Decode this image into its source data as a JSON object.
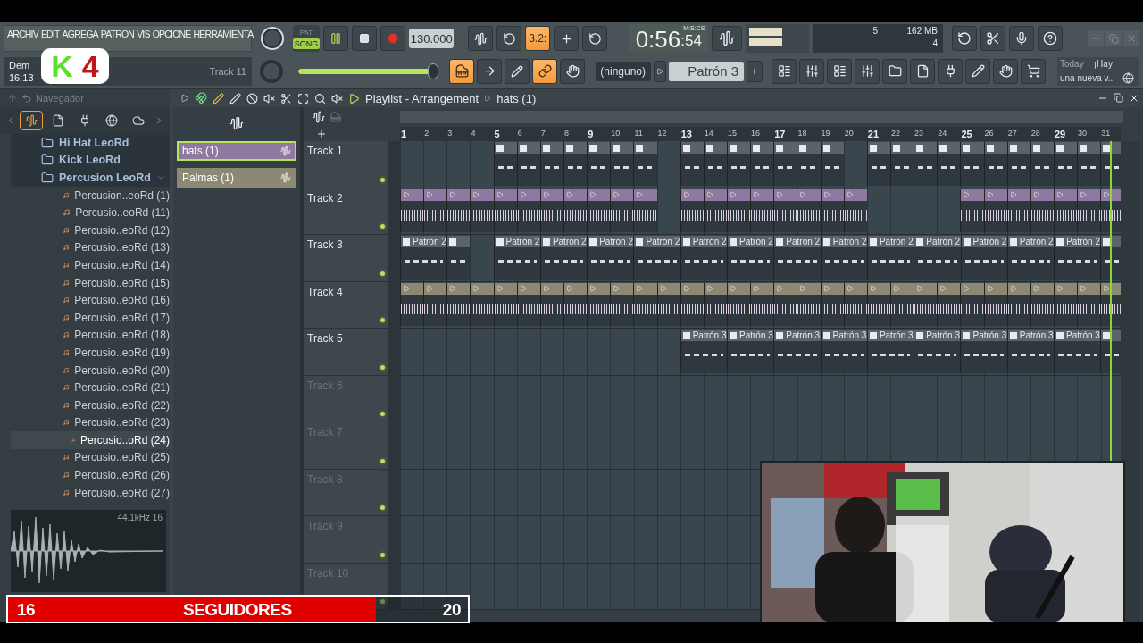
{
  "menu": [
    "ARCHIV",
    "EDIT",
    "AGREGA",
    "PATRON",
    "VIS",
    "OPCIONE",
    "HERRAMIENTA"
  ],
  "hint": {
    "line_1": "Dem",
    "line_2": "16:13",
    "target": "Track 11"
  },
  "logo": {
    "letter": "K",
    "number": "4"
  },
  "transport": {
    "modes": [
      {
        "label": "PAT",
        "selected": false
      },
      {
        "label": "SONG",
        "selected": true
      }
    ],
    "playing": true,
    "tempo": "130.000",
    "master_volume": {
      "level": 0.97
    }
  },
  "snap_label": "3.2:",
  "time": {
    "value": "0:56",
    "subvalue": ":54",
    "format": "M:S:CS"
  },
  "cpu": {
    "voices": "5",
    "memory": "162 MB",
    "polyphony": "4"
  },
  "pattern": {
    "mixer_target": "(ninguno)",
    "current": "Patrón 3",
    "add": "+"
  },
  "news": {
    "label": "Today",
    "text_1": "¡Hay",
    "text_2": "una nueva v.."
  },
  "browser": {
    "title": "Navegador",
    "tabs": [
      {
        "selected": true
      },
      {
        "selected": false
      },
      {
        "selected": false
      },
      {
        "selected": false
      },
      {
        "selected": false
      }
    ],
    "tree": [
      {
        "label": "Hi Hat LeoRd",
        "kind": "folder",
        "selected": false,
        "expanded": false
      },
      {
        "label": "Kick LeoRd",
        "kind": "folder",
        "selected": false,
        "expanded": false
      },
      {
        "label": "Percusion  LeoRd",
        "kind": "folder",
        "selected": false,
        "expanded": true,
        "children": [
          {
            "label": "Percusion..eoRd (1)",
            "kind": "file",
            "selected": false
          },
          {
            "label": "Percusio..eoRd (11)",
            "kind": "file",
            "selected": false
          },
          {
            "label": "Percusio..eoRd (12)",
            "kind": "file",
            "selected": false
          },
          {
            "label": "Percusio..eoRd (13)",
            "kind": "file",
            "selected": false
          },
          {
            "label": "Percusio..eoRd (14)",
            "kind": "file",
            "selected": false
          },
          {
            "label": "Percusio..eoRd (15)",
            "kind": "file",
            "selected": false
          },
          {
            "label": "Percusio..eoRd (16)",
            "kind": "file",
            "selected": false
          },
          {
            "label": "Percusio..eoRd (17)",
            "kind": "file",
            "selected": false
          },
          {
            "label": "Percusio..eoRd (18)",
            "kind": "file",
            "selected": false
          },
          {
            "label": "Percusio..eoRd (19)",
            "kind": "file",
            "selected": false
          },
          {
            "label": "Percusio..eoRd (20)",
            "kind": "file",
            "selected": false
          },
          {
            "label": "Percusio..eoRd (21)",
            "kind": "file",
            "selected": false
          },
          {
            "label": "Percusio..eoRd (22)",
            "kind": "file",
            "selected": false
          },
          {
            "label": "Percusio..eoRd (23)",
            "kind": "file",
            "selected": false
          },
          {
            "label": "Percusio..oRd (24)",
            "kind": "file",
            "selected": true
          },
          {
            "label": "Percusio..eoRd (25)",
            "kind": "file",
            "selected": false
          },
          {
            "label": "Percusio..eoRd (26)",
            "kind": "file",
            "selected": false
          },
          {
            "label": "Percusio..eoRd (27)",
            "kind": "file",
            "selected": false
          }
        ]
      }
    ]
  },
  "preview": {
    "info": "44.1kHz 16"
  },
  "picker": [
    {
      "label": "hats (1)",
      "selected": true,
      "color": "#8e7aa0"
    },
    {
      "label": "Palmas (1)",
      "selected": false,
      "color": "#8c8872"
    }
  ],
  "playlist": {
    "title": "Playlist - Arrangement",
    "pattern": "hats (1)",
    "bars": [
      "1",
      "2",
      "3",
      "4",
      "5",
      "6",
      "7",
      "8",
      "9",
      "10",
      "11",
      "12",
      "13",
      "14",
      "15",
      "16",
      "17",
      "18",
      "19",
      "20",
      "21",
      "22",
      "23",
      "24",
      "25",
      "26",
      "27",
      "28",
      "29",
      "30",
      "31"
    ],
    "playhead": {
      "level": 0.985
    },
    "tracks": [
      {
        "name": "Track 1",
        "dimmed": false,
        "color": "#5b6369",
        "slots": [
          {
            "kind": "empty"
          },
          {
            "kind": "empty"
          },
          {
            "kind": "empty"
          },
          {
            "kind": "empty"
          },
          {
            "kind": "pattern"
          },
          {
            "kind": "pattern"
          },
          {
            "kind": "pattern"
          },
          {
            "kind": "pattern"
          },
          {
            "kind": "pattern"
          },
          {
            "kind": "pattern"
          },
          {
            "kind": "pattern"
          },
          {
            "kind": "empty"
          },
          {
            "kind": "pattern"
          },
          {
            "kind": "pattern"
          },
          {
            "kind": "pattern"
          },
          {
            "kind": "pattern"
          },
          {
            "kind": "pattern"
          },
          {
            "kind": "pattern"
          },
          {
            "kind": "pattern"
          },
          {
            "kind": "empty"
          },
          {
            "kind": "pattern"
          },
          {
            "kind": "pattern"
          },
          {
            "kind": "pattern"
          },
          {
            "kind": "pattern"
          },
          {
            "kind": "pattern"
          },
          {
            "kind": "pattern"
          },
          {
            "kind": "pattern"
          },
          {
            "kind": "pattern"
          },
          {
            "kind": "pattern"
          },
          {
            "kind": "pattern"
          },
          {
            "kind": "pattern"
          }
        ]
      },
      {
        "name": "Track 2",
        "dimmed": false,
        "color": "#8e7aa0",
        "slots": [
          {
            "kind": "audio"
          },
          {
            "kind": "audio"
          },
          {
            "kind": "audio"
          },
          {
            "kind": "audio"
          },
          {
            "kind": "audio"
          },
          {
            "kind": "audio"
          },
          {
            "kind": "audio"
          },
          {
            "kind": "audio"
          },
          {
            "kind": "audio"
          },
          {
            "kind": "audio"
          },
          {
            "kind": "audio"
          },
          {
            "kind": "empty"
          },
          {
            "kind": "audio"
          },
          {
            "kind": "audio"
          },
          {
            "kind": "audio"
          },
          {
            "kind": "audio"
          },
          {
            "kind": "audio"
          },
          {
            "kind": "audio"
          },
          {
            "kind": "audio"
          },
          {
            "kind": "audio"
          },
          {
            "kind": "empty"
          },
          {
            "kind": "empty"
          },
          {
            "kind": "empty"
          },
          {
            "kind": "empty"
          },
          {
            "kind": "audio"
          },
          {
            "kind": "audio"
          },
          {
            "kind": "audio"
          },
          {
            "kind": "audio"
          },
          {
            "kind": "audio"
          },
          {
            "kind": "audio"
          },
          {
            "kind": "audio"
          }
        ]
      },
      {
        "name": "Track 3",
        "dimmed": false,
        "color": "#5b6369",
        "slots": [
          {
            "kind": "pattern2",
            "label": "Patrón 2"
          },
          {
            "kind": "pattern"
          },
          {
            "kind": "empty"
          },
          {
            "kind": "pattern2",
            "label": "Patrón 2"
          },
          {
            "kind": "pattern2",
            "label": "Patrón 2"
          },
          {
            "kind": "pattern2",
            "label": "Patrón 2"
          },
          {
            "kind": "pattern2",
            "label": "Patrón 2"
          },
          {
            "kind": "pattern2",
            "label": "Patrón 2"
          },
          {
            "kind": "pattern2",
            "label": "Patrón 2"
          },
          {
            "kind": "pattern2",
            "label": "Patrón 2"
          },
          {
            "kind": "pattern2",
            "label": "Patrón 2"
          },
          {
            "kind": "pattern2",
            "label": "Patrón 2"
          },
          {
            "kind": "pattern2",
            "label": "Patrón 2"
          },
          {
            "kind": "pattern2",
            "label": "Patrón 2"
          },
          {
            "kind": "pattern2",
            "label": "Patrón 2"
          },
          {
            "kind": "pattern2",
            "label": "Patrón 2"
          },
          {
            "kind": "pattern"
          }
        ]
      },
      {
        "name": "Track 4",
        "dimmed": false,
        "color": "#8c8872",
        "slots": [
          {
            "kind": "audio"
          },
          {
            "kind": "audio"
          },
          {
            "kind": "audio"
          },
          {
            "kind": "audio"
          },
          {
            "kind": "audio"
          },
          {
            "kind": "audio"
          },
          {
            "kind": "audio"
          },
          {
            "kind": "audio"
          },
          {
            "kind": "audio"
          },
          {
            "kind": "audio"
          },
          {
            "kind": "audio"
          },
          {
            "kind": "audio"
          },
          {
            "kind": "audio"
          },
          {
            "kind": "audio"
          },
          {
            "kind": "audio"
          },
          {
            "kind": "audio"
          },
          {
            "kind": "audio"
          },
          {
            "kind": "audio"
          },
          {
            "kind": "audio"
          },
          {
            "kind": "audio"
          },
          {
            "kind": "audio"
          },
          {
            "kind": "audio"
          },
          {
            "kind": "audio"
          },
          {
            "kind": "audio"
          },
          {
            "kind": "audio"
          },
          {
            "kind": "audio"
          },
          {
            "kind": "audio"
          },
          {
            "kind": "audio"
          },
          {
            "kind": "audio"
          },
          {
            "kind": "audio"
          },
          {
            "kind": "audio"
          }
        ]
      },
      {
        "name": "Track 5",
        "dimmed": false,
        "color": "#5b6369",
        "slots": [
          {
            "kind": "empty"
          },
          {
            "kind": "empty"
          },
          {
            "kind": "empty"
          },
          {
            "kind": "empty"
          },
          {
            "kind": "empty"
          },
          {
            "kind": "empty"
          },
          {
            "kind": "empty"
          },
          {
            "kind": "empty"
          },
          {
            "kind": "empty"
          },
          {
            "kind": "empty"
          },
          {
            "kind": "empty"
          },
          {
            "kind": "empty"
          },
          {
            "kind": "pattern2",
            "label": "Patrón 3"
          },
          {
            "kind": "pattern2",
            "label": "Patrón 3"
          },
          {
            "kind": "pattern2",
            "label": "Patrón 3"
          },
          {
            "kind": "pattern2",
            "label": "Patrón 3"
          },
          {
            "kind": "pattern2",
            "label": "Patrón 3"
          },
          {
            "kind": "pattern2",
            "label": "Patrón 3"
          },
          {
            "kind": "pattern2",
            "label": "Patrón 3"
          },
          {
            "kind": "pattern2",
            "label": "Patrón 3"
          },
          {
            "kind": "pattern2",
            "label": "Patrón 3"
          },
          {
            "kind": "pattern"
          }
        ]
      },
      {
        "name": "Track 6",
        "dimmed": true
      },
      {
        "name": "Track 7",
        "dimmed": true
      },
      {
        "name": "Track 8",
        "dimmed": true
      },
      {
        "name": "Track 9",
        "dimmed": true
      },
      {
        "name": "Track 10",
        "dimmed": true
      }
    ]
  },
  "followers": {
    "current": "16",
    "label": "SEGUIDORES",
    "goal": "20",
    "level": 0.8
  }
}
